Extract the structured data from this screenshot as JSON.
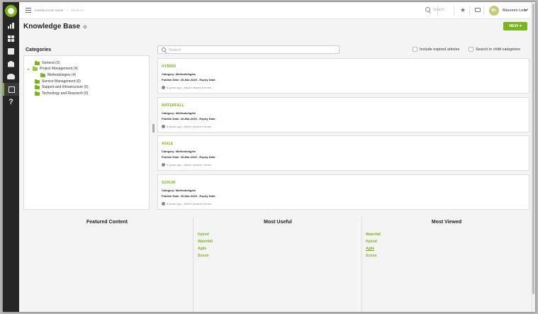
{
  "sidebar": {
    "icons": [
      "analytics-icon",
      "dashboard-icon",
      "documents-icon",
      "institution-icon",
      "users-icon",
      "external-link-icon",
      "help-icon"
    ],
    "help_label": "?"
  },
  "topbar": {
    "breadcrumb": {
      "root": "KNOWLEDGE BASE",
      "separator": ">",
      "current": "SEARCH"
    },
    "search_placeholder": "Search",
    "user": {
      "initials": "ML",
      "name": "Maureen Lee"
    }
  },
  "page": {
    "title": "Knowledge Base",
    "new_button": "NEW",
    "new_caret": "▾"
  },
  "categories": {
    "title": "Categories",
    "items": [
      {
        "label": "General (0)"
      },
      {
        "label": "Project Management (4)",
        "toggle": "▾"
      },
      {
        "label": "Methodologies (4)"
      },
      {
        "label": "Service Management (0)"
      },
      {
        "label": "Support and Infrastructure (0)"
      },
      {
        "label": "Technology and Research (0)"
      }
    ]
  },
  "search": {
    "placeholder": "Search",
    "include_expired": "Include expired articles",
    "search_child": "Search in child categories"
  },
  "articles": [
    {
      "title": "HYBRID",
      "category_label": "Category:",
      "category": "Methodologies",
      "publish_label": "Publish Date:",
      "publish": "20-Mar-2020",
      "expiry_label": "- Expiry Date:",
      "meta": "5 years ago - Article viewed 5 times."
    },
    {
      "title": "WATERFALL",
      "category_label": "Category:",
      "category": "Methodologies",
      "publish_label": "Publish Date:",
      "publish": "20-Mar-2020",
      "expiry_label": "- Expiry Date:",
      "meta": "5 years ago - Article viewed 4 times."
    },
    {
      "title": "AGILE",
      "category_label": "Category:",
      "category": "Methodologies",
      "publish_label": "Publish Date:",
      "publish": "20-Mar-2020",
      "expiry_label": "- Expiry Date:",
      "meta": "5 years ago - Article viewed 1 times."
    },
    {
      "title": "SCRUM",
      "category_label": "Category:",
      "category": "Methodologies",
      "publish_label": "Publish Date:",
      "publish": "20-Mar-2020",
      "expiry_label": "- Expiry Date:",
      "meta": "5 years ago - Article viewed 0 times."
    }
  ],
  "featured": {
    "title": "Featured Content"
  },
  "most_useful": {
    "title": "Most Useful",
    "links": [
      "Hybrid",
      "Waterfall",
      "Agile",
      "Scrum"
    ]
  },
  "most_viewed": {
    "title": "Most Viewed",
    "links": [
      "Waterfall",
      "Hybrid",
      "Agile",
      "Scrum"
    ]
  },
  "colors": {
    "accent": "#7ab51d",
    "sidebar": "#262626"
  }
}
